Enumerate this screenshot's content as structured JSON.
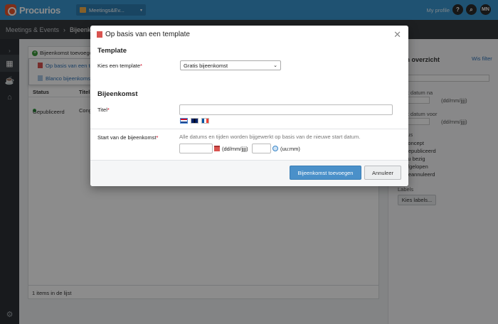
{
  "topbar": {
    "logo_text": "Procurios",
    "event_select": "Meetings&Ev...",
    "profile_link": "My profile",
    "help_label": "?",
    "search_icon": "magnifier-icon",
    "avatar_initials": "MN",
    "brand_color": "#3a96d0"
  },
  "breadcrumb": {
    "root": "Meetings & Events",
    "separator": "›",
    "current": "Bijeenkomsten"
  },
  "list": {
    "add_button": "Bijeenkomst toevoegen",
    "dropdown": {
      "items": [
        {
          "label": "Op basis van een template"
        },
        {
          "label": "Blanco bijeenkomst"
        }
      ]
    },
    "columns": {
      "status": "Status",
      "title": "Titel"
    },
    "rows": [
      {
        "status": "Gepubliceerd",
        "title": "Congres"
      }
    ],
    "footer": "1 items in de lijst"
  },
  "filters": {
    "title": "Lijn overzicht",
    "clear": "Wis filter",
    "date_after": "Start datum na",
    "date_before": "Start datum voor",
    "date_format": "(dd/mm/jjjj)",
    "status_label": "Status",
    "status_options": [
      "Concept",
      "Gepubliceerd",
      "Nu bezig",
      "Afgelopen",
      "Geannuleerd"
    ],
    "labels_heading": "Labels",
    "labels_button": "Kies labels..."
  },
  "modal": {
    "title": "Op basis van een template",
    "close_icon": "close-icon",
    "template_section": "Template",
    "template_label": "Kies een template",
    "required_mark": "*",
    "template_value": "Gratis bijeenkomst",
    "event_section": "Bijeenkomst",
    "title_label": "Titel",
    "title_value": "",
    "languages": [
      "nl",
      "en",
      "fr"
    ],
    "start_label": "Start van de bijeenkomst",
    "start_hint": "Alle datums en tijden worden bijgewerkt op basis van de nieuwe start datum.",
    "date_value": "",
    "date_format": "(dd/mm/jjjj)",
    "time_value": "",
    "time_format": "(uu:mm)",
    "submit_button": "Bijeenkomst toevoegen",
    "cancel_button": "Annuleer"
  }
}
